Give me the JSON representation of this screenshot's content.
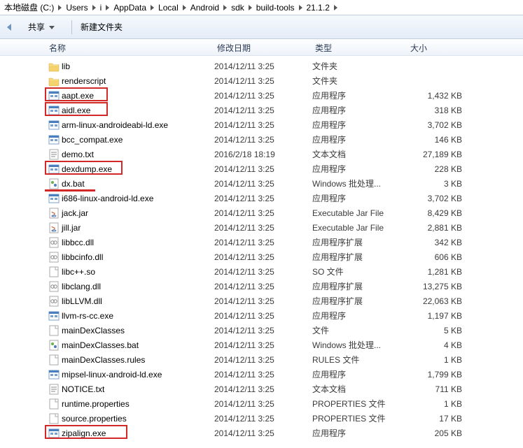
{
  "breadcrumb": [
    "本地磁盘 (C:)",
    "Users",
    "i",
    "AppData",
    "Local",
    "Android",
    "sdk",
    "build-tools",
    "21.1.2"
  ],
  "toolbar": {
    "share": "共享",
    "newFolder": "新建文件夹"
  },
  "columns": {
    "name": "名称",
    "date": "修改日期",
    "type": "类型",
    "size": "大小"
  },
  "files": [
    {
      "icon": "folder",
      "name": "lib",
      "date": "2014/12/11 3:25",
      "type": "文件夹",
      "size": ""
    },
    {
      "icon": "folder",
      "name": "renderscript",
      "date": "2014/12/11 3:25",
      "type": "文件夹",
      "size": ""
    },
    {
      "icon": "exe",
      "name": "aapt.exe",
      "date": "2014/12/11 3:25",
      "type": "应用程序",
      "size": "1,432 KB",
      "hl": "box"
    },
    {
      "icon": "exe",
      "name": "aidl.exe",
      "date": "2014/12/11 3:25",
      "type": "应用程序",
      "size": "318 KB",
      "hl": "box"
    },
    {
      "icon": "exe",
      "name": "arm-linux-androideabi-ld.exe",
      "date": "2014/12/11 3:25",
      "type": "应用程序",
      "size": "3,702 KB"
    },
    {
      "icon": "exe",
      "name": "bcc_compat.exe",
      "date": "2014/12/11 3:25",
      "type": "应用程序",
      "size": "146 KB"
    },
    {
      "icon": "txt",
      "name": "demo.txt",
      "date": "2016/2/18 18:19",
      "type": "文本文档",
      "size": "27,189 KB"
    },
    {
      "icon": "exe",
      "name": "dexdump.exe",
      "date": "2014/12/11 3:25",
      "type": "应用程序",
      "size": "228 KB",
      "hl": "box"
    },
    {
      "icon": "bat",
      "name": "dx.bat",
      "date": "2014/12/11 3:25",
      "type": "Windows 批处理...",
      "size": "3 KB",
      "hl": "underline"
    },
    {
      "icon": "exe",
      "name": "i686-linux-android-ld.exe",
      "date": "2014/12/11 3:25",
      "type": "应用程序",
      "size": "3,702 KB"
    },
    {
      "icon": "jar",
      "name": "jack.jar",
      "date": "2014/12/11 3:25",
      "type": "Executable Jar File",
      "size": "8,429 KB"
    },
    {
      "icon": "jar",
      "name": "jill.jar",
      "date": "2014/12/11 3:25",
      "type": "Executable Jar File",
      "size": "2,881 KB"
    },
    {
      "icon": "dll",
      "name": "libbcc.dll",
      "date": "2014/12/11 3:25",
      "type": "应用程序扩展",
      "size": "342 KB"
    },
    {
      "icon": "dll",
      "name": "libbcinfo.dll",
      "date": "2014/12/11 3:25",
      "type": "应用程序扩展",
      "size": "606 KB"
    },
    {
      "icon": "so",
      "name": "libc++.so",
      "date": "2014/12/11 3:25",
      "type": "SO 文件",
      "size": "1,281 KB"
    },
    {
      "icon": "dll",
      "name": "libclang.dll",
      "date": "2014/12/11 3:25",
      "type": "应用程序扩展",
      "size": "13,275 KB"
    },
    {
      "icon": "dll",
      "name": "libLLVM.dll",
      "date": "2014/12/11 3:25",
      "type": "应用程序扩展",
      "size": "22,063 KB"
    },
    {
      "icon": "exe",
      "name": "llvm-rs-cc.exe",
      "date": "2014/12/11 3:25",
      "type": "应用程序",
      "size": "1,197 KB"
    },
    {
      "icon": "file",
      "name": "mainDexClasses",
      "date": "2014/12/11 3:25",
      "type": "文件",
      "size": "5 KB"
    },
    {
      "icon": "bat",
      "name": "mainDexClasses.bat",
      "date": "2014/12/11 3:25",
      "type": "Windows 批处理...",
      "size": "4 KB"
    },
    {
      "icon": "rules",
      "name": "mainDexClasses.rules",
      "date": "2014/12/11 3:25",
      "type": "RULES 文件",
      "size": "1 KB"
    },
    {
      "icon": "exe",
      "name": "mipsel-linux-android-ld.exe",
      "date": "2014/12/11 3:25",
      "type": "应用程序",
      "size": "1,799 KB"
    },
    {
      "icon": "txt",
      "name": "NOTICE.txt",
      "date": "2014/12/11 3:25",
      "type": "文本文档",
      "size": "711 KB"
    },
    {
      "icon": "props",
      "name": "runtime.properties",
      "date": "2014/12/11 3:25",
      "type": "PROPERTIES 文件",
      "size": "1 KB"
    },
    {
      "icon": "props",
      "name": "source.properties",
      "date": "2014/12/11 3:25",
      "type": "PROPERTIES 文件",
      "size": "17 KB"
    },
    {
      "icon": "exe",
      "name": "zipalign.exe",
      "date": "2014/12/11 3:25",
      "type": "应用程序",
      "size": "205 KB",
      "hl": "box"
    }
  ]
}
